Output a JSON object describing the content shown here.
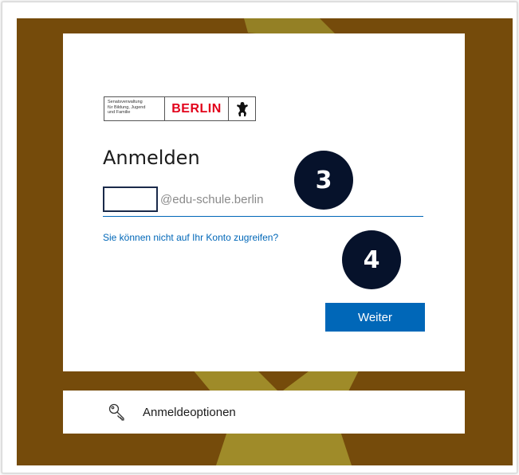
{
  "logo": {
    "department_lines": [
      "Senatsverwaltung",
      "für Bildung, Jugend",
      "und Familie"
    ],
    "city": "BERLIN"
  },
  "signin": {
    "title": "Anmelden",
    "email_suffix": "@edu-schule.berlin",
    "email_value": "",
    "cant_access_link": "Sie können nicht auf Ihr Konto zugreifen?",
    "next_button": "Weiter"
  },
  "annotations": {
    "step_3": "3",
    "step_4": "4"
  },
  "options": {
    "label": "Anmeldeoptionen",
    "icon": "key-icon"
  },
  "colors": {
    "backdrop": "#754b0b",
    "accent": "#0067b8",
    "badge": "#06122b",
    "logo_red": "#e2001a"
  }
}
